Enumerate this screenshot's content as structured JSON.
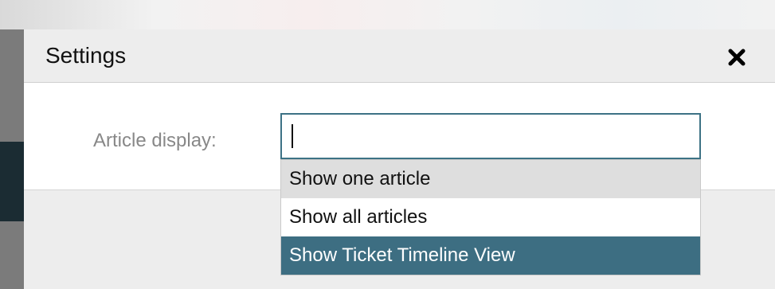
{
  "dialog": {
    "title": "Settings",
    "close_icon": "close-icon"
  },
  "field": {
    "label": "Article display:",
    "value": ""
  },
  "dropdown": {
    "options": [
      {
        "label": "Show one article",
        "state": "hover"
      },
      {
        "label": "Show all articles",
        "state": "normal"
      },
      {
        "label": "Show Ticket Timeline View",
        "state": "selected"
      }
    ]
  },
  "colors": {
    "accent": "#3d6e82",
    "header_bg": "#ededed",
    "overlay": "#7b7b7b"
  }
}
